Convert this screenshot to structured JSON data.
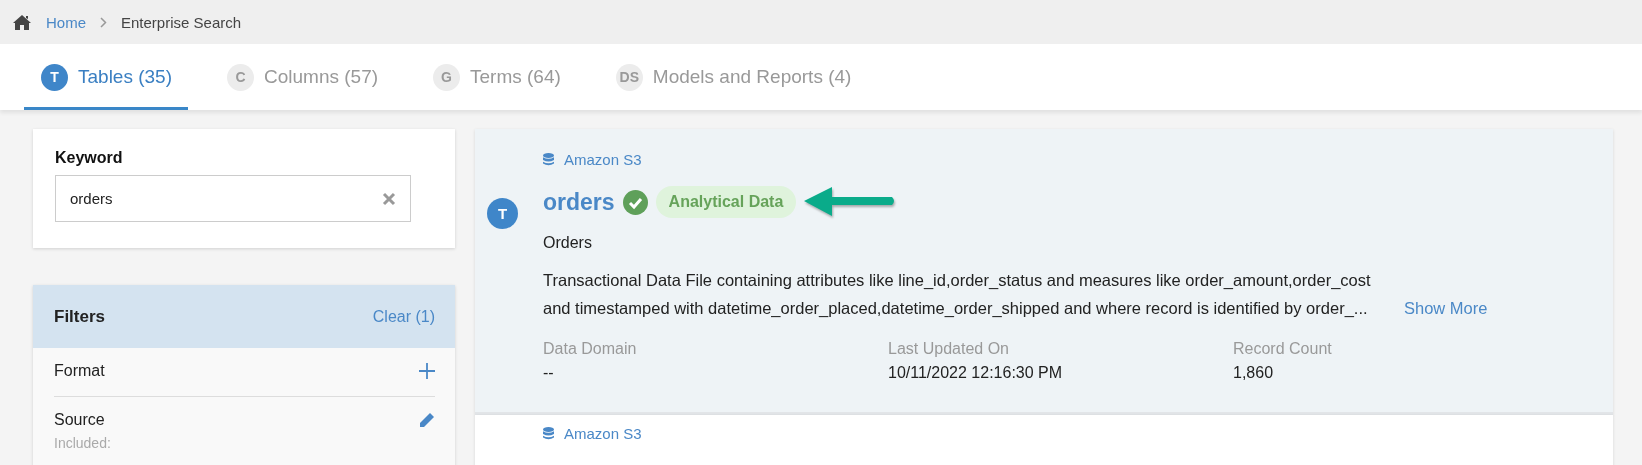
{
  "breadcrumb": [
    {
      "label": "Home",
      "kind": "link"
    },
    {
      "label": "Enterprise Search",
      "kind": "current"
    }
  ],
  "tabs": [
    {
      "badge": "T",
      "label": "Tables (35)",
      "selected": true
    },
    {
      "badge": "C",
      "label": "Columns (57)",
      "selected": false
    },
    {
      "badge": "G",
      "label": "Terms (64)",
      "selected": false
    },
    {
      "badge": "DS",
      "label": "Models and Reports (4)",
      "selected": false
    }
  ],
  "keyword": {
    "label": "Keyword",
    "value": "orders"
  },
  "filters": {
    "title": "Filters",
    "clear": "Clear (1)",
    "sections": [
      {
        "title": "Format",
        "kind": "add"
      },
      {
        "title": "Source",
        "kind": "edit",
        "note": "Included:"
      }
    ]
  },
  "results": [
    {
      "source": "Amazon S3",
      "type_badge": "T",
      "name": "orders",
      "certified": true,
      "tag": "Analytical Data",
      "subtitle": "Orders",
      "description": "Transactional Data File containing attributes like line_id,order_status and measures like order_amount,order_cost and timestamped with datetime_order_placed,datetime_order_shipped and where record is identified by order_...",
      "show_more": "Show More",
      "highlighted": true,
      "meta": [
        {
          "label": "Data Domain",
          "value": "--"
        },
        {
          "label": "Last Updated On",
          "value": "10/11/2022 12:16:30 PM"
        },
        {
          "label": "Record Count",
          "value": "1,860"
        }
      ]
    },
    {
      "source": "Amazon S3",
      "highlighted": false
    }
  ]
}
